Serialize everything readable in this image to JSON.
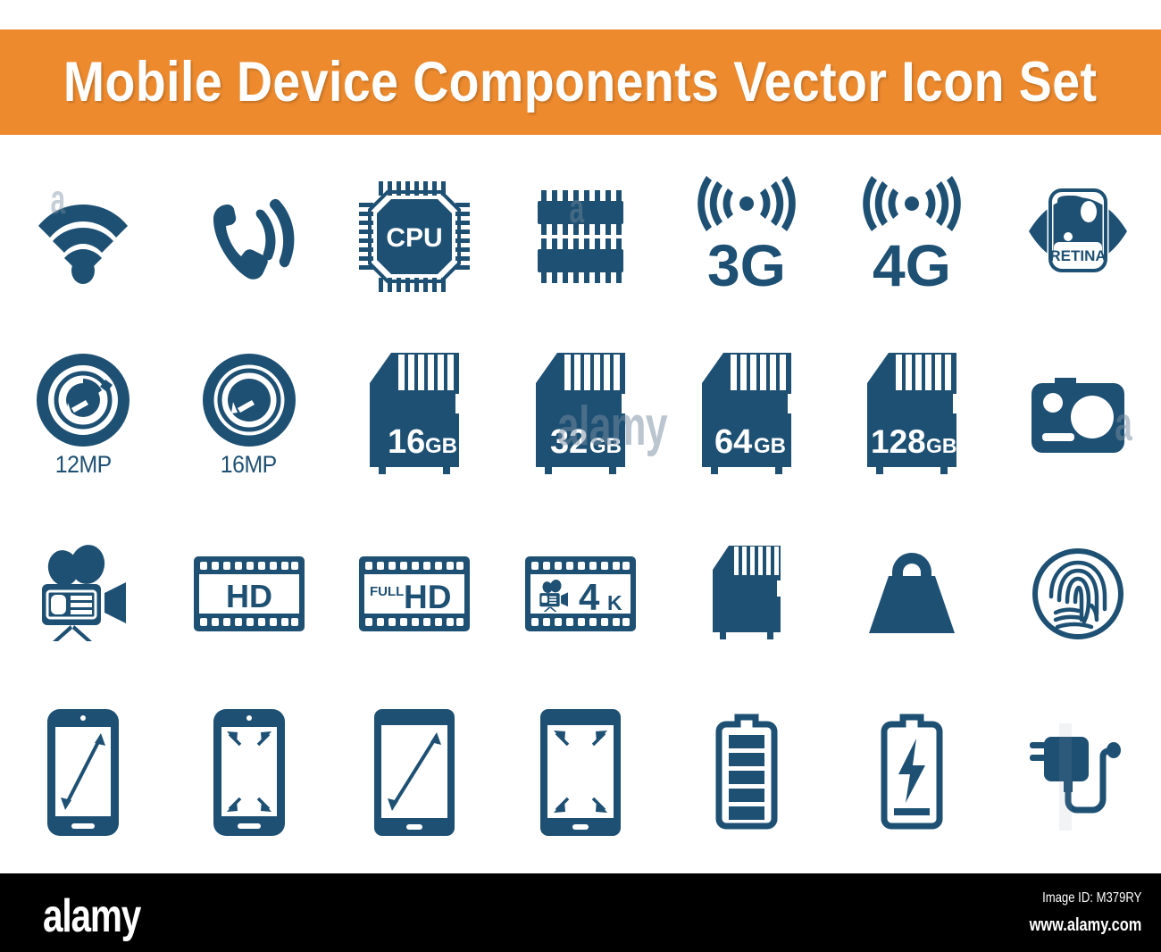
{
  "banner": {
    "title": "Mobile Device Components Vector Icon Set",
    "background_color": "#ED8A2E",
    "text_color": "#FFFFFF"
  },
  "theme": {
    "icon_color": "#1E5073",
    "page_background": "#FFFFFF",
    "footer_background": "#000000"
  },
  "watermarks": {
    "mark_a": "a",
    "mark_alamy": "alamy"
  },
  "grid": {
    "columns": 7,
    "rows": 4,
    "icons": [
      {
        "name": "wifi",
        "label": "",
        "caption": ""
      },
      {
        "name": "phone-call",
        "label": "",
        "caption": ""
      },
      {
        "name": "cpu",
        "label": "CPU",
        "caption": ""
      },
      {
        "name": "ram-chip",
        "label": "",
        "caption": ""
      },
      {
        "name": "network-3g",
        "label": "3G",
        "caption": ""
      },
      {
        "name": "network-4g",
        "label": "4G",
        "caption": ""
      },
      {
        "name": "retina-display",
        "label": "RETINA",
        "caption": ""
      },
      {
        "name": "camera-12mp",
        "label": "",
        "caption": "12MP"
      },
      {
        "name": "camera-16mp",
        "label": "",
        "caption": "16MP"
      },
      {
        "name": "sd-card-16gb",
        "label": "16",
        "unit": "GB",
        "caption": ""
      },
      {
        "name": "sd-card-32gb",
        "label": "32",
        "unit": "GB",
        "caption": ""
      },
      {
        "name": "sd-card-64gb",
        "label": "64",
        "unit": "GB",
        "caption": ""
      },
      {
        "name": "sd-card-128gb",
        "label": "128",
        "unit": "GB",
        "caption": ""
      },
      {
        "name": "action-camera",
        "label": "",
        "caption": ""
      },
      {
        "name": "video-camera",
        "label": "",
        "caption": ""
      },
      {
        "name": "film-hd",
        "label": "HD",
        "caption": ""
      },
      {
        "name": "film-full-hd",
        "label": "HD",
        "prefix": "FULL",
        "caption": ""
      },
      {
        "name": "film-4k",
        "label": "4",
        "unit": "K",
        "caption": ""
      },
      {
        "name": "sd-card-blank",
        "label": "",
        "caption": ""
      },
      {
        "name": "weight",
        "label": "",
        "caption": ""
      },
      {
        "name": "fingerprint",
        "label": "",
        "caption": ""
      },
      {
        "name": "phone-screen-diagonal",
        "label": "",
        "caption": ""
      },
      {
        "name": "phone-screen-corners",
        "label": "",
        "caption": ""
      },
      {
        "name": "tablet-screen-diagonal",
        "label": "",
        "caption": ""
      },
      {
        "name": "tablet-screen-corners",
        "label": "",
        "caption": ""
      },
      {
        "name": "battery-full",
        "label": "",
        "caption": ""
      },
      {
        "name": "battery-charging",
        "label": "",
        "caption": ""
      },
      {
        "name": "power-charger",
        "label": "",
        "caption": ""
      }
    ]
  },
  "footer": {
    "logo": "alamy",
    "image_id": "Image ID: M379RY",
    "website": "www.alamy.com"
  }
}
